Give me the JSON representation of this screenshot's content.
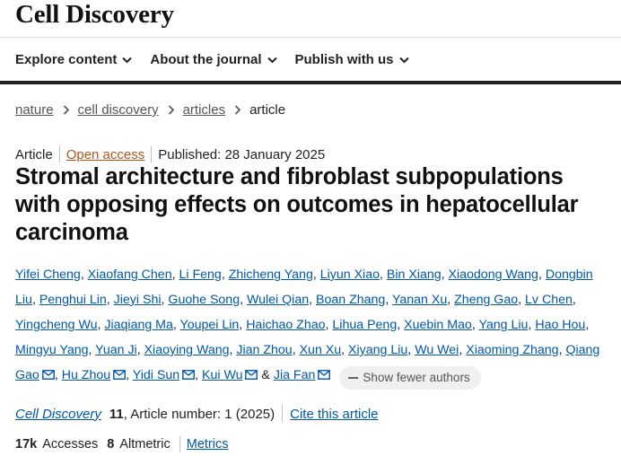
{
  "brand": "Cell Discovery",
  "nav": {
    "items": [
      {
        "label": "Explore content"
      },
      {
        "label": "About the journal"
      },
      {
        "label": "Publish with us"
      }
    ]
  },
  "breadcrumb": [
    "nature",
    "cell discovery",
    "articles",
    "article"
  ],
  "article": {
    "type": "Article",
    "access": "Open access",
    "published": "Published: 28 January 2025",
    "title": "Stromal architecture and fibroblast subpopulations with opposing effects on outcomes in hepatocellular carcinoma"
  },
  "authors": [
    {
      "name": "Yifei Cheng",
      "mail": false
    },
    {
      "name": "Xiaofang Chen",
      "mail": false
    },
    {
      "name": "Li Feng",
      "mail": false
    },
    {
      "name": "Zhicheng Yang",
      "mail": false
    },
    {
      "name": "Liyun Xiao",
      "mail": false
    },
    {
      "name": "Bin Xiang",
      "mail": false
    },
    {
      "name": "Xiaodong Wang",
      "mail": false
    },
    {
      "name": "Dongbin Liu",
      "mail": false
    },
    {
      "name": "Penghui Lin",
      "mail": false
    },
    {
      "name": "Jieyi Shi",
      "mail": false
    },
    {
      "name": "Guohe Song",
      "mail": false
    },
    {
      "name": "Wulei Qian",
      "mail": false
    },
    {
      "name": "Boan Zhang",
      "mail": false
    },
    {
      "name": "Yanan Xu",
      "mail": false
    },
    {
      "name": "Zheng Gao",
      "mail": false
    },
    {
      "name": "Lv Chen",
      "mail": false
    },
    {
      "name": "Yingcheng Wu",
      "mail": false
    },
    {
      "name": "Jiaqiang Ma",
      "mail": false
    },
    {
      "name": "Youpei Lin",
      "mail": false
    },
    {
      "name": "Haichao Zhao",
      "mail": false
    },
    {
      "name": "Lihua Peng",
      "mail": false
    },
    {
      "name": "Xuebin Mao",
      "mail": false
    },
    {
      "name": "Yang Liu",
      "mail": false
    },
    {
      "name": "Hao Hou",
      "mail": false
    },
    {
      "name": "Mingyu Yang",
      "mail": false
    },
    {
      "name": "Yuan Ji",
      "mail": false
    },
    {
      "name": "Xiaoying Wang",
      "mail": false
    },
    {
      "name": "Jian Zhou",
      "mail": false
    },
    {
      "name": "Xun Xu",
      "mail": false
    },
    {
      "name": "Xiyang Liu",
      "mail": false
    },
    {
      "name": "Wu Wei",
      "mail": false
    },
    {
      "name": "Xiaoming Zhang",
      "mail": false
    },
    {
      "name": "Qiang Gao",
      "mail": true
    },
    {
      "name": "Hu Zhou",
      "mail": true
    },
    {
      "name": "Yidi Sun",
      "mail": true
    },
    {
      "name": "Kui Wu",
      "mail": true
    },
    {
      "name": "Jia Fan",
      "mail": true
    }
  ],
  "show_fewer_label": "Show fewer authors",
  "citation": {
    "journal": "Cell Discovery",
    "volume": "11",
    "details": ", Article number: 1 (2025)",
    "cite_label": "Cite this article"
  },
  "metrics": {
    "accesses_value": "17k",
    "accesses_label": "Accesses",
    "altmetric_value": "8",
    "altmetric_label": "Altmetric",
    "metrics_link": "Metrics"
  }
}
